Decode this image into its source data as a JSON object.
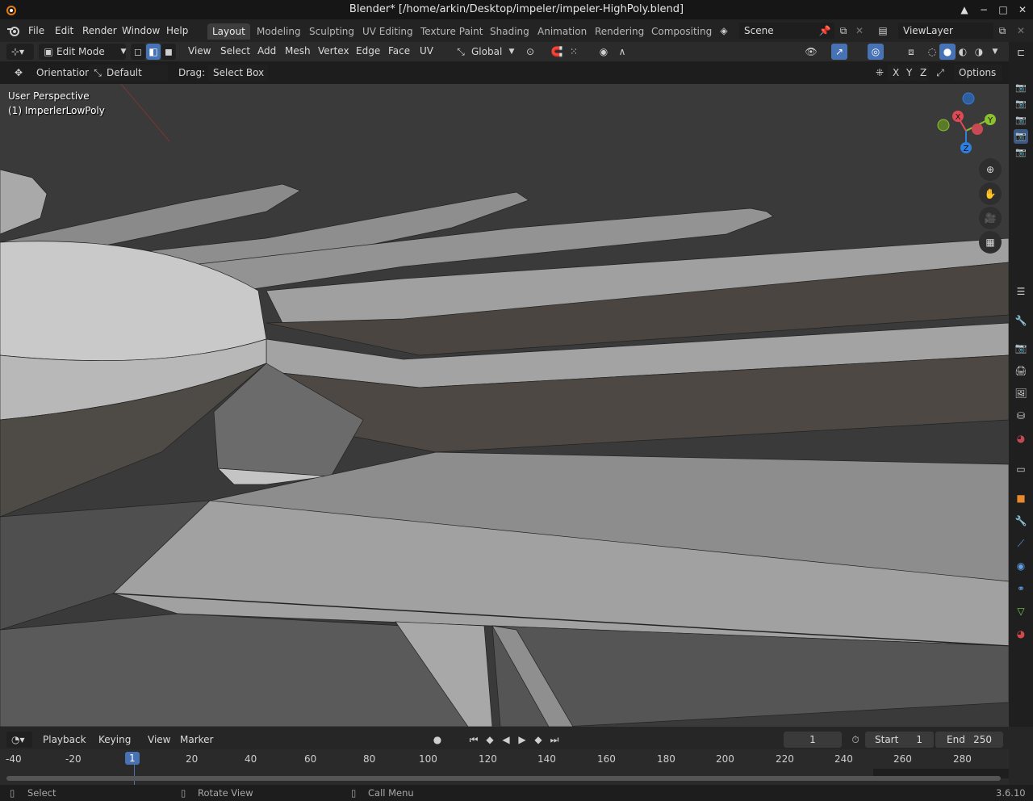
{
  "window": {
    "title": "Blender* [/home/arkin/Desktop/impeler/impeler-HighPoly.blend]",
    "controls": [
      "▲",
      "−",
      "□",
      "✕"
    ]
  },
  "menu": [
    "File",
    "Edit",
    "Render",
    "Window",
    "Help"
  ],
  "workspaces": [
    "Layout",
    "Modeling",
    "Sculpting",
    "UV Editing",
    "Texture Paint",
    "Shading",
    "Animation",
    "Rendering",
    "Compositing"
  ],
  "scene": {
    "name": "Scene"
  },
  "view_layer": {
    "name": "ViewLayer"
  },
  "header": {
    "mode": "Edit Mode",
    "menus": [
      "View",
      "Select",
      "Add",
      "Mesh",
      "Vertex",
      "Edge",
      "Face",
      "UV"
    ],
    "transform_orientation": "Global"
  },
  "tool_settings": {
    "orientation_label": "Orientation:",
    "orientation_value": "Default",
    "drag_label": "Drag:",
    "drag_value": "Select Box",
    "axes": [
      "X",
      "Y",
      "Z"
    ],
    "options_label": "Options"
  },
  "viewport": {
    "perspective": "User Perspective",
    "object": "(1) ImperlerLowPoly",
    "gizmo_axes": [
      "X",
      "Y",
      "Z"
    ]
  },
  "timeline": {
    "menus": [
      "Playback",
      "Keying",
      "View",
      "Marker"
    ],
    "current_frame": "1",
    "start_label": "Start",
    "start_value": "1",
    "end_label": "End",
    "end_value": "250",
    "ruler": [
      "-40",
      "-20",
      "1",
      "20",
      "40",
      "60",
      "80",
      "100",
      "120",
      "140",
      "160",
      "180",
      "200",
      "220",
      "240",
      "260",
      "280"
    ]
  },
  "status": {
    "select": "Select",
    "rotate": "Rotate View",
    "call_menu": "Call Menu",
    "version": "3.6.10"
  },
  "colors": {
    "accent": "#4772b3",
    "x_axis": "#e04a55",
    "y_axis": "#8bc12f",
    "z_axis": "#2f7fe0"
  }
}
